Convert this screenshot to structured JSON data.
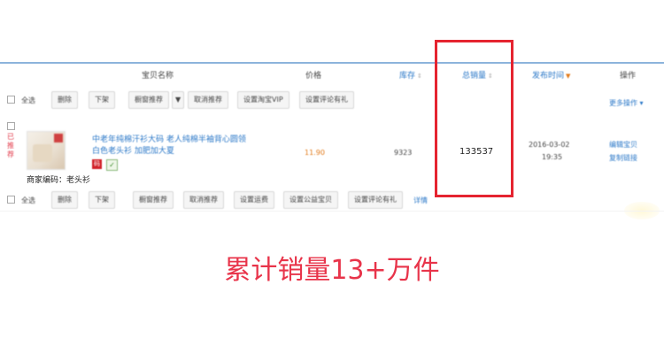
{
  "columns": {
    "name": "宝贝名称",
    "price": "价格",
    "stock": "库存",
    "total_sales": "总销量",
    "publish_time": "发布时间",
    "operation": "操作"
  },
  "toolbar_top": {
    "select_all": "全选",
    "delete": "删除",
    "delist": "下架",
    "recommend": "橱窗推荐",
    "cancel_recommend": "取消推荐",
    "set_vip": "设置淘宝VIP",
    "set_review": "设置评论有礼",
    "more_ops": "更多操作"
  },
  "product": {
    "status_badge": "已推荐",
    "title": "中老年纯棉汗衫大码 老人纯棉半袖背心圆领白色老头衫 加肥加大夏",
    "code_icon": "码",
    "price": "11.90",
    "stock": "9323",
    "total_sales": "133537",
    "publish_date": "2016-03-02",
    "publish_clock": "19:35",
    "edit_link": "编辑宝贝",
    "copy_link": "复制链接",
    "merchant_code": "商家编码：老头衫"
  },
  "toolbar_bottom": {
    "select_all": "全选",
    "delete": "删除",
    "delist": "下架",
    "recommend": "橱窗推荐",
    "cancel_recommend": "取消推荐",
    "set_discount": "设置运费",
    "set_charity": "设置公益宝贝",
    "set_review": "设置评论有礼",
    "detail": "详情"
  },
  "caption": "累计销量13+万件",
  "colors": {
    "highlight": "#e52430",
    "caption": "#e8344a",
    "link": "#2b78c8"
  }
}
